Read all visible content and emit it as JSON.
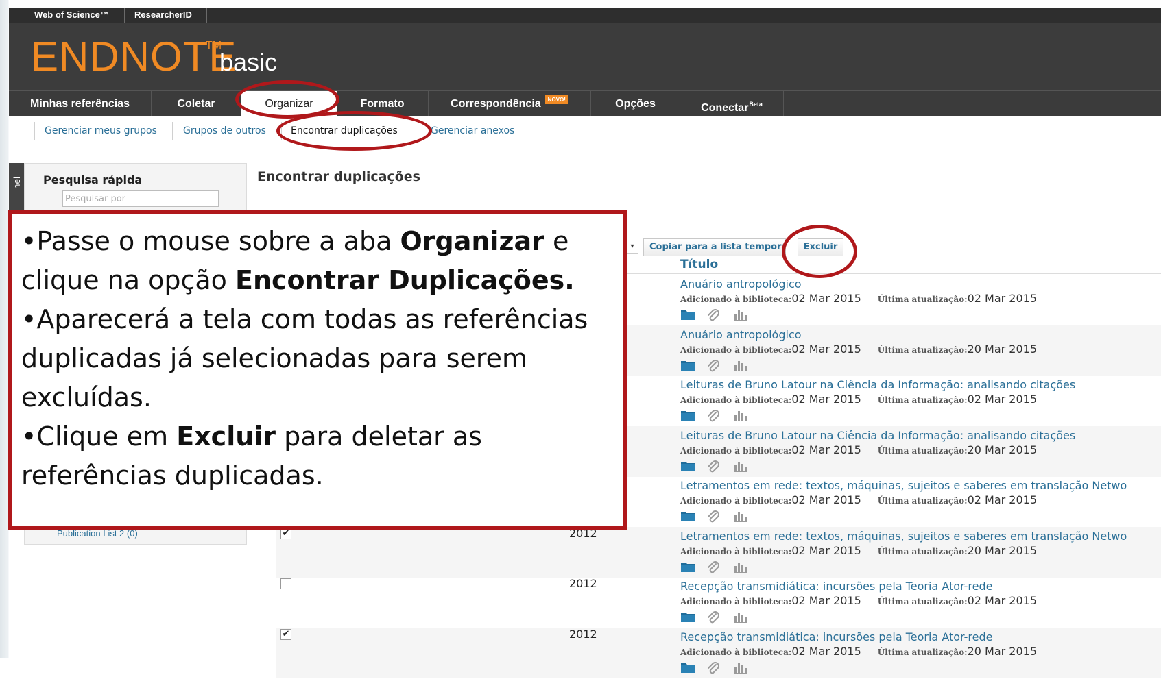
{
  "topbar": {
    "links": [
      "Web of Science™",
      "ResearcherID"
    ]
  },
  "brand": {
    "name": "ENDNOTE",
    "tm": "TM",
    "edition": "basic"
  },
  "mainnav": {
    "tabs": [
      "Minhas referências",
      "Coletar",
      "Organizar",
      "Formato",
      "Correspondência",
      "Opções",
      "Conectar"
    ],
    "badge_novo": "NOVO!",
    "badge_beta": "Beta"
  },
  "subnav": {
    "links": [
      "Gerenciar meus grupos",
      "Grupos de outros",
      "Encontrar duplicações",
      "Gerenciar anexos"
    ]
  },
  "sidebar": {
    "tab_label": "nel",
    "panel_title": "Pesquisa rápida",
    "search_placeholder": "Pesquisar por",
    "publication_list": "Publication List 2 (0)"
  },
  "content": {
    "title": "Encontrar duplicações",
    "copy_button": "Copiar para a lista temporária",
    "delete_button": "Excluir",
    "column_title": "Título",
    "meta_added_label": "Adicionado à biblioteca:",
    "meta_updated_label": "Última atualização:"
  },
  "records": [
    {
      "title": "Anuário antropológico",
      "year": "",
      "checked": true,
      "added": "02 Mar 2015",
      "updated": "02 Mar 2015"
    },
    {
      "title": "Anuário antropológico",
      "year": "",
      "checked": true,
      "added": "02 Mar 2015",
      "updated": "20 Mar 2015"
    },
    {
      "title": "Leituras de Bruno Latour na Ciência da Informação: analisando citações",
      "year": "",
      "checked": true,
      "added": "02 Mar 2015",
      "updated": "02 Mar 2015"
    },
    {
      "title": "Leituras de Bruno Latour na Ciência da Informação: analisando citações",
      "year": "",
      "checked": true,
      "added": "02 Mar 2015",
      "updated": "20 Mar 2015"
    },
    {
      "title": "Letramentos em rede: textos, máquinas, sujeitos e saberes em translação Netwo",
      "year": "",
      "checked": true,
      "added": "02 Mar 2015",
      "updated": "02 Mar 2015"
    },
    {
      "title": "Letramentos em rede: textos, máquinas, sujeitos e saberes em translação Netwo",
      "year": "2012",
      "checked": true,
      "added": "02 Mar 2015",
      "updated": "20 Mar 2015"
    },
    {
      "title": "Recepção transmidiática: incursões pela Teoria Ator-rede",
      "year": "2012",
      "checked": false,
      "added": "02 Mar 2015",
      "updated": "02 Mar 2015"
    },
    {
      "title": "Recepção transmidiática: incursões pela Teoria Ator-rede",
      "year": "2012",
      "checked": true,
      "added": "02 Mar 2015",
      "updated": "20 Mar 2015"
    }
  ],
  "callout": {
    "lines": [
      [
        {
          "t": "•Passe o mouse sobre a aba "
        },
        {
          "t": "Organizar",
          "b": true
        },
        {
          "t": " e"
        }
      ],
      [
        {
          "t": "clique na opção "
        },
        {
          "t": "Encontrar Duplicações.",
          "b": true
        }
      ],
      [
        {
          "t": "•Aparecerá a tela com todas as referências"
        }
      ],
      [
        {
          "t": "duplicadas já selecionadas para serem"
        }
      ],
      [
        {
          "t": "excluídas."
        }
      ],
      [
        {
          "t": "•Clique em "
        },
        {
          "t": "Excluir",
          "b": true
        },
        {
          "t": " para deletar as"
        }
      ],
      [
        {
          "t": "referências duplicadas."
        }
      ]
    ]
  },
  "colors": {
    "accent_red": "#b0181b",
    "brand_orange": "#f08a24",
    "link_blue": "#2a6f97",
    "nav_dark": "#3b3b3b"
  }
}
